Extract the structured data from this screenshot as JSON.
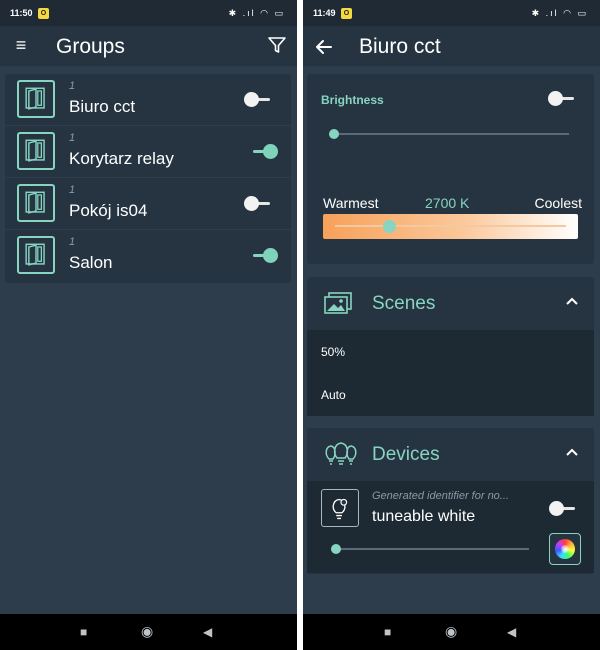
{
  "colors": {
    "accent": "#87d5c0",
    "background": "#2e3d4b",
    "card": "#263441",
    "dark_row": "#1d2933",
    "statusbar": "#1f2a35"
  },
  "left_screen": {
    "statusbar": {
      "time": "11:50",
      "icons": "✱ .ıl ◠ ▭"
    },
    "toolbar": {
      "title": "Groups",
      "menu_icon": "hamburger-menu-icon",
      "filter_icon": "filter-icon"
    },
    "groups": [
      {
        "count": "1",
        "name": "Biuro cct",
        "on": false
      },
      {
        "count": "1",
        "name": "Korytarz relay",
        "on": true
      },
      {
        "count": "1",
        "name": "Pokój is04",
        "on": false
      },
      {
        "count": "1",
        "name": "Salon",
        "on": true
      }
    ]
  },
  "right_screen": {
    "statusbar": {
      "time": "11:49",
      "icons": "✱ .ıl ◠ ▭"
    },
    "toolbar": {
      "title": "Biuro cct",
      "back_icon": "arrow-back-icon"
    },
    "brightness": {
      "label": "Brightness",
      "on": false,
      "value": 0
    },
    "color_temp": {
      "warmest": "Warmest",
      "value": "2700 K",
      "coolest": "Coolest"
    },
    "scenes": {
      "title": "Scenes",
      "icon": "scenes-icon",
      "expanded": true,
      "items": [
        "50%",
        "Auto"
      ]
    },
    "devices": {
      "title": "Devices",
      "icon": "bulbs-icon",
      "expanded": true,
      "items": [
        {
          "id": "Generated identifier for no...",
          "name": "tuneable white",
          "on": false,
          "brightness": 0,
          "color_icon": "color-wheel-icon"
        }
      ]
    }
  },
  "navbar": {
    "icons": [
      "recents-square-icon",
      "home-circle-icon",
      "back-triangle-icon"
    ]
  }
}
